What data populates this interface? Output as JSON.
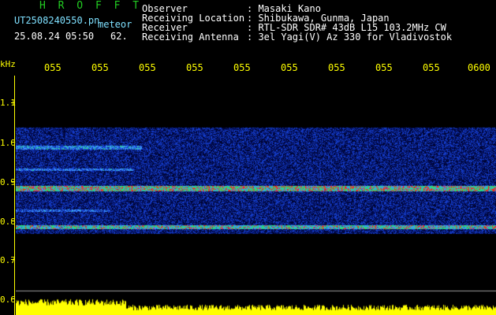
{
  "header": {
    "station": "H R O F F T",
    "filename": "UT2508240550.pn",
    "label": "meteor",
    "datetime": "25.08.24 05:50",
    "count": "62.",
    "fields": [
      {
        "key": "Observer",
        "value": ": Masaki Kano"
      },
      {
        "key": "Receiving Location",
        "value": ": Shibukawa, Gunma, Japan"
      },
      {
        "key": "Receiver",
        "value": ": RTL-SDR SDR# 43dB L15 103.2MHz CW"
      },
      {
        "key": "Receiving Antenna",
        "value": ": 3el Yagi(V) Az 330 for Vladivostok"
      }
    ]
  },
  "axes": {
    "y_unit": "kHz",
    "y_ticks": [
      "1.1",
      "1.0",
      "0.9",
      "0.8",
      "0.7",
      "0.6"
    ],
    "x_ticks": [
      "055",
      "055",
      "055",
      "055",
      "055",
      "055",
      "055",
      "055",
      "055",
      "0600"
    ]
  },
  "colors": {
    "background": "#000000",
    "station": "#22cc22",
    "axis": "#ffff00",
    "text": "#ffffff"
  }
}
